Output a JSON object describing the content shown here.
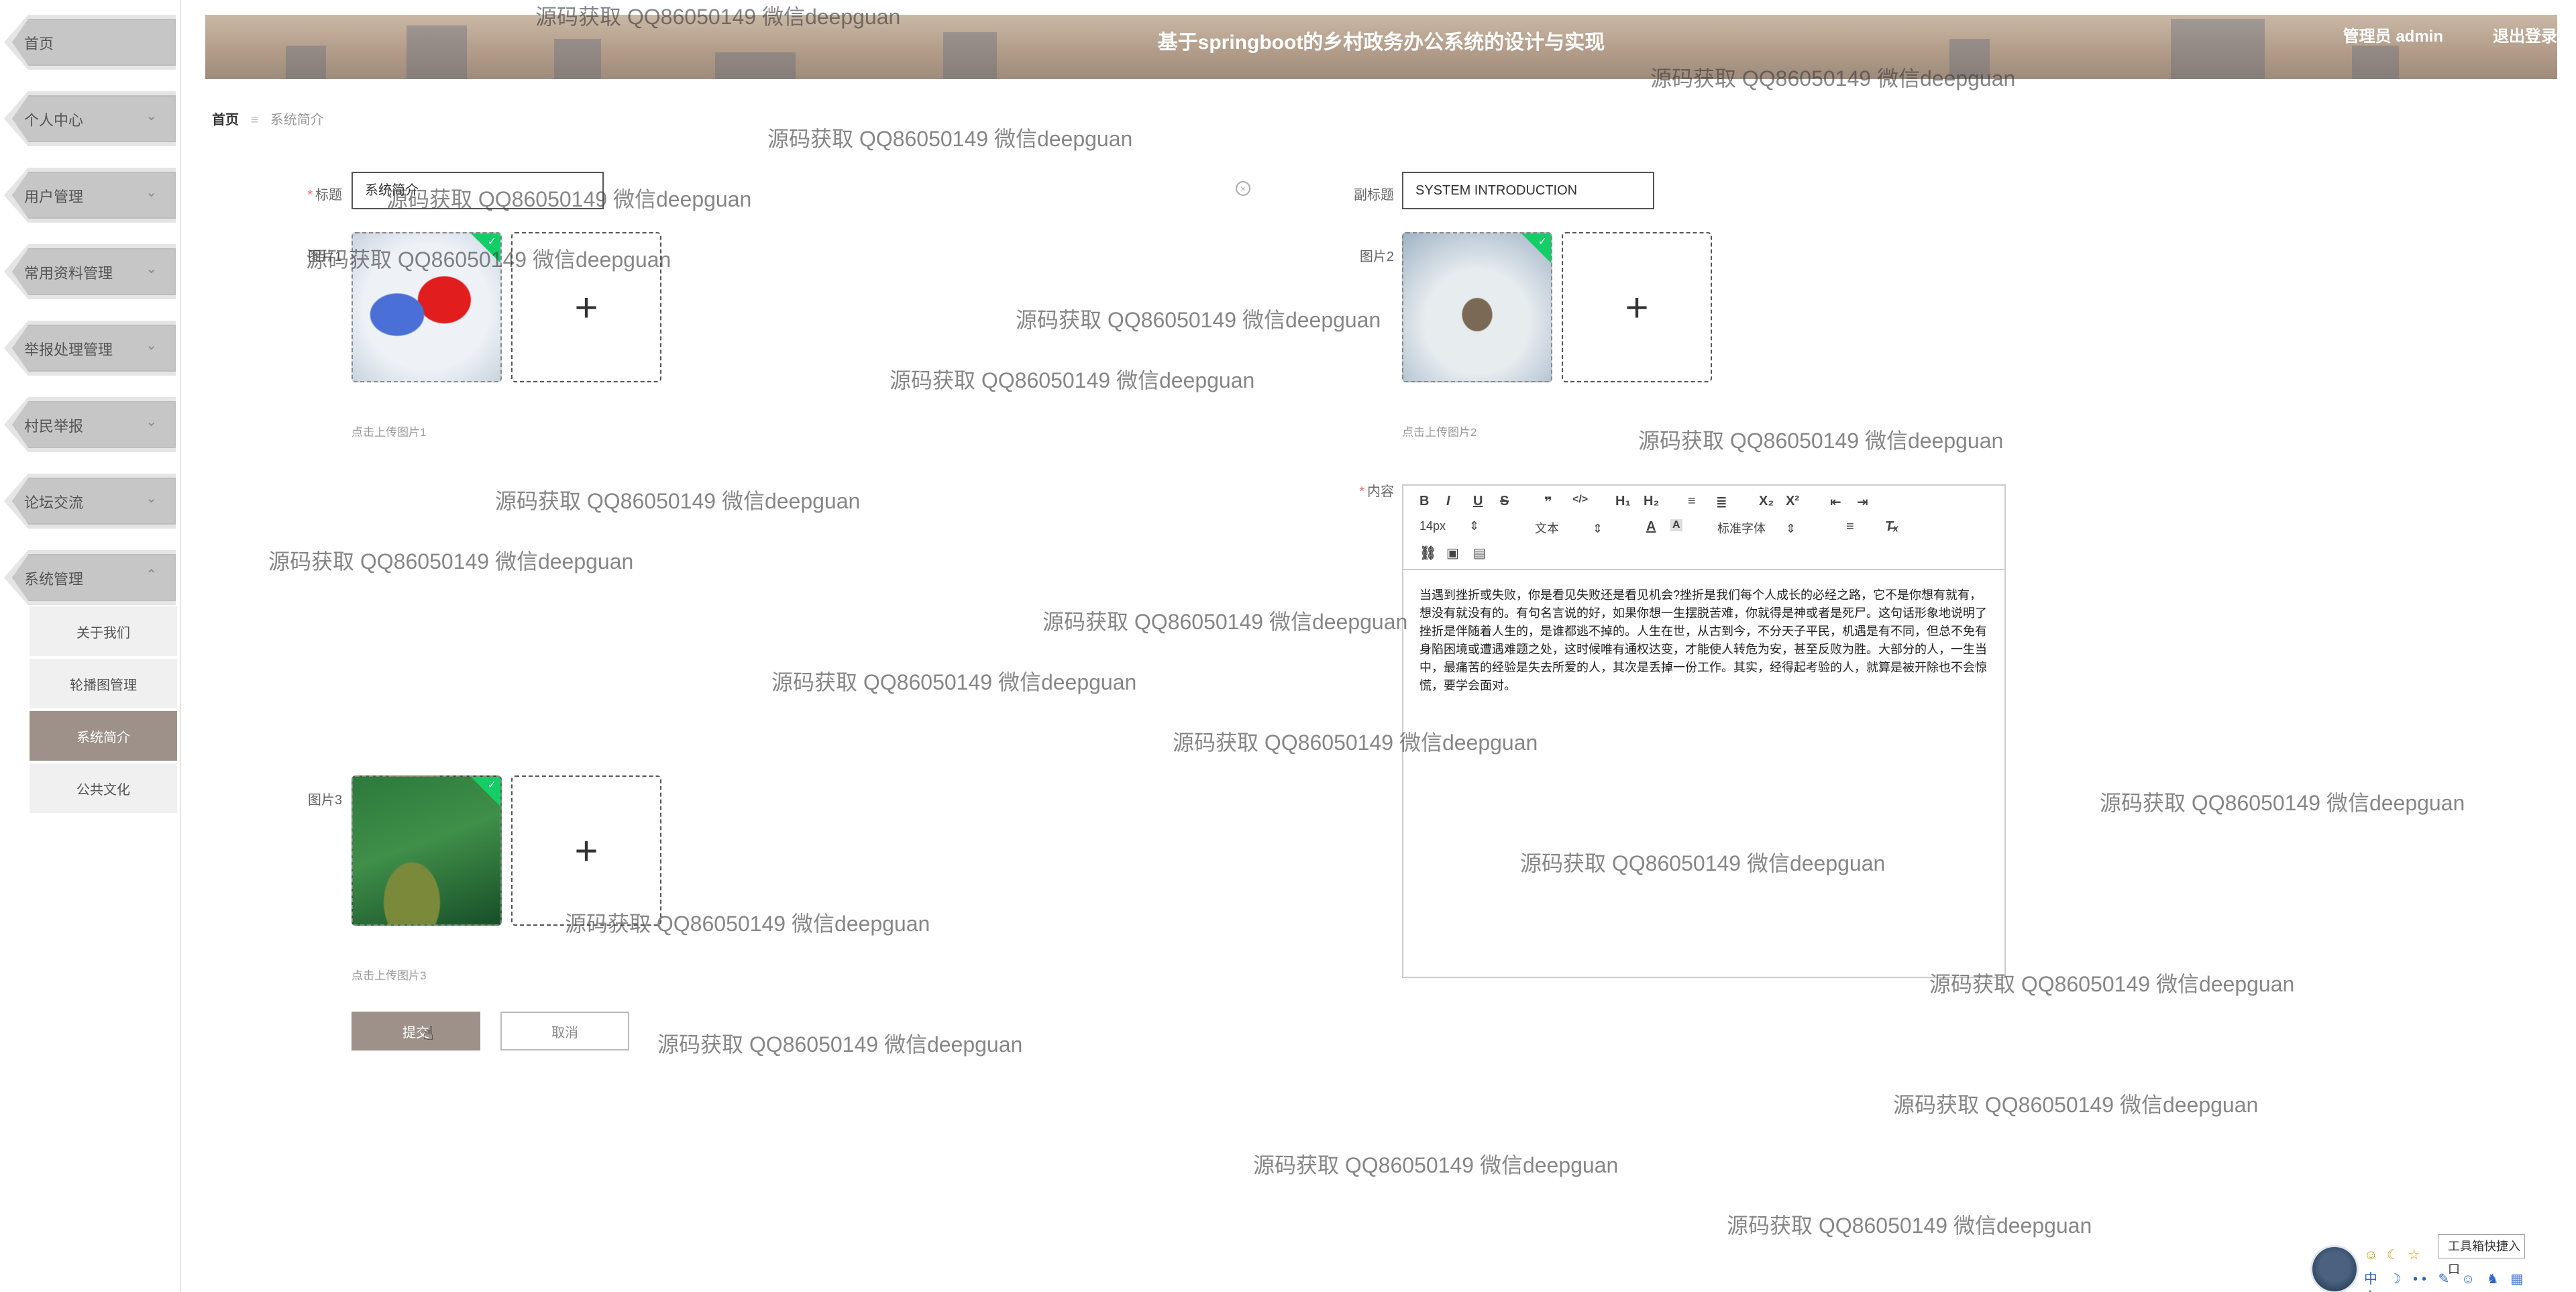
{
  "header": {
    "title": "基于springboot的乡村政务办公系统的设计与实现",
    "user": "管理员 admin",
    "logout": "退出登录"
  },
  "sidebar": {
    "items": [
      {
        "label": "首页",
        "expandable": false
      },
      {
        "label": "个人中心",
        "expandable": true
      },
      {
        "label": "用户管理",
        "expandable": true
      },
      {
        "label": "常用资料管理",
        "expandable": true
      },
      {
        "label": "举报处理管理",
        "expandable": true
      },
      {
        "label": "村民举报",
        "expandable": true
      },
      {
        "label": "论坛交流",
        "expandable": true
      },
      {
        "label": "系统管理",
        "expandable": true,
        "expanded": true
      }
    ],
    "submenu": [
      {
        "label": "关于我们"
      },
      {
        "label": "轮播图管理"
      },
      {
        "label": "系统简介",
        "active": true
      },
      {
        "label": "公共文化"
      }
    ]
  },
  "breadcrumb": {
    "home": "首页",
    "separator": "≡",
    "current": "系统简介"
  },
  "form": {
    "title_label": "标题",
    "title_value": "系统简介",
    "subtitle_label": "副标题",
    "subtitle_value": "SYSTEM INTRODUCTION",
    "image1_label": "图片1",
    "image1_hint": "点击上传图片1",
    "image2_label": "图片2",
    "image2_hint": "点击上传图片2",
    "image3_label": "图片3",
    "image3_hint": "点击上传图片3",
    "content_label": "内容",
    "upload_plus": "+",
    "submit": "提交",
    "cancel": "取消"
  },
  "editor": {
    "bold": "B",
    "italic": "I",
    "underline": "U",
    "strike": "S",
    "quote": "❞",
    "code": "</>",
    "h1": "H₁",
    "h2": "H₂",
    "ordered_list": "≡",
    "bullet_list": "≣",
    "sub": "X₂",
    "sup": "X²",
    "outdent": "⇤",
    "indent": "⇥",
    "font_size": "14px",
    "block_type": "文本",
    "font_family": "标准字体",
    "content": "当遇到挫折或失败，你是看见失败还是看见机会?挫折是我们每个人成长的必经之路，它不是你想有就有，想没有就没有的。有句名言说的好，如果你想一生摆脱苦难，你就得是神或者是死尸。这句话形象地说明了挫折是伴随着人生的，是谁都逃不掉的。人生在世，从古到今，不分天子平民，机遇是有不同，但总不免有身陷困境或遭遇难题之处，这时候唯有通权达变，才能使人转危为安，甚至反败为胜。大部分的人，一生当中，最痛苦的经验是失去所爱的人，其次是丢掉一份工作。其实，经得起考验的人，就算是被开除也不会惊慌，要学会面对。"
  },
  "watermark": "源码获取 QQ86050149 微信deepguan",
  "widget": {
    "title": "工具箱快捷入口",
    "close": "✕",
    "icons": "中 ☽ •• ✎ ☺ ♞ ▦ ♙",
    "emoji": "☺ ☾ ☆"
  }
}
